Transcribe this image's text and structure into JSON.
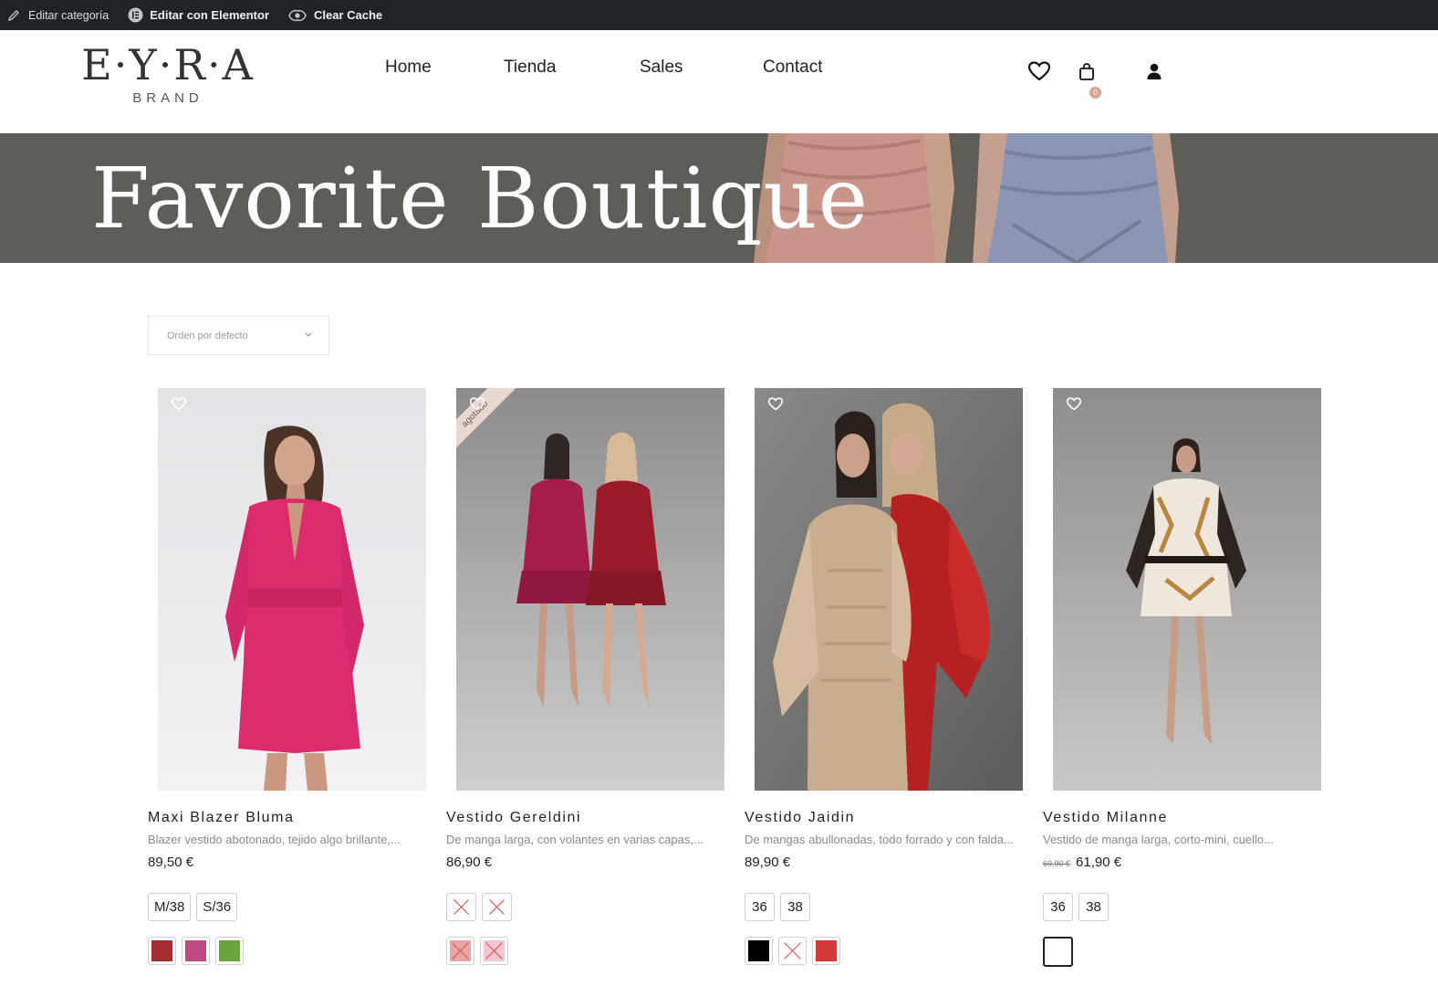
{
  "admin_bar": {
    "items": [
      {
        "label": "Editar categoría",
        "icon": "pencil-icon"
      },
      {
        "label": "Editar con Elementor",
        "icon": "elementor-icon"
      },
      {
        "label": "Clear Cache",
        "icon": "cache-icon"
      }
    ]
  },
  "header": {
    "logo_main": "E·Y·R·A",
    "logo_sub": "BRAND",
    "nav": [
      "Home",
      "Tienda",
      "Sales",
      "Contact"
    ],
    "cart_count": "0",
    "icons": [
      "heart-icon",
      "cart-icon",
      "user-icon"
    ]
  },
  "hero": {
    "title": "Favorite Boutique"
  },
  "sort": {
    "selected": "Orden por defecto"
  },
  "products": [
    {
      "name": "Maxi Blazer Bluma",
      "desc": "Blazer vestido abotonado, tejido algo brillante,...",
      "price": "89,50 €",
      "old_price": "",
      "badge": "",
      "sizes": [
        {
          "label": "M/38",
          "available": true
        },
        {
          "label": "S/36",
          "available": true
        }
      ],
      "colors": [
        {
          "hex": "#a42d2f",
          "available": true
        },
        {
          "hex": "#bf4a80",
          "available": true
        },
        {
          "hex": "#6aa43c",
          "available": true
        }
      ]
    },
    {
      "name": "Vestido Gereldini",
      "desc": "De manga larga, con volantes en varias capas,...",
      "price": "86,90 €",
      "old_price": "",
      "badge": "agotado",
      "sizes": [
        {
          "label": "",
          "available": false
        },
        {
          "label": "",
          "available": false
        }
      ],
      "colors": [
        {
          "hex": "#e7a5a5",
          "available": false
        },
        {
          "hex": "#f3c6d3",
          "available": false
        }
      ]
    },
    {
      "name": "Vestido Jaidin",
      "desc": "De mangas abullonadas, todo forrado y con falda...",
      "price": "89,90 €",
      "old_price": "",
      "badge": "",
      "sizes": [
        {
          "label": "36",
          "available": true
        },
        {
          "label": "38",
          "available": true
        }
      ],
      "colors": [
        {
          "hex": "#000000",
          "available": true
        },
        {
          "hex": "#ffffff",
          "available": false
        },
        {
          "hex": "#d23a35",
          "available": true
        }
      ]
    },
    {
      "name": "Vestido Milanne",
      "desc": "Vestido de manga larga, corto-mini, cuello...",
      "price": "61,90 €",
      "old_price": "69,90 €",
      "badge": "",
      "sizes": [
        {
          "label": "36",
          "available": true
        },
        {
          "label": "38",
          "available": true
        }
      ],
      "colors": [
        {
          "hex": "#ffffff",
          "available": true,
          "selected": true
        }
      ]
    }
  ],
  "accent": "#d9a48d"
}
